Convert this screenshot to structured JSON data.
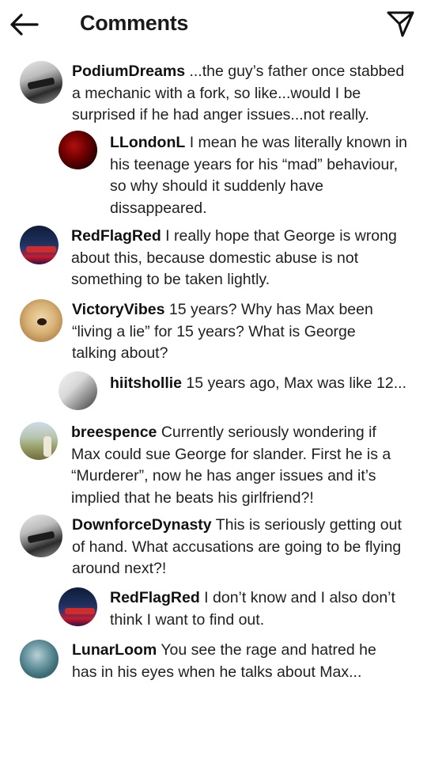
{
  "header": {
    "title": "Comments",
    "back_icon": "arrow-left-icon",
    "send_icon": "paper-plane-icon"
  },
  "comments": [
    {
      "username": "PodiumDreams",
      "text": " ...the guy’s father once stabbed a mechanic with a fork, so like...would I be surprised if he had anger issues...not really.",
      "avatar": "race-car-photo",
      "reply": false
    },
    {
      "username": "LLondonL",
      "text": " I mean he was literally known in his teenage years for his “mad” behaviour, so why should it suddenly have dissappeared.",
      "avatar": "red-roses-photo",
      "reply": true
    },
    {
      "username": "RedFlagRed",
      "text": " I really hope that George is wrong about this, because domestic abuse is not something to be taken lightly.",
      "avatar": "racing-team-photo",
      "reply": false
    },
    {
      "username": "VictoryVibes",
      "text": " 15 years? Why has Max been “living a lie” for 15 years? What is George talking about?",
      "avatar": "dog-photo",
      "reply": false
    },
    {
      "username": "hiitshollie",
      "text": " 15 years ago, Max was like 12...",
      "avatar": "couple-photo",
      "reply": true
    },
    {
      "username": "breespence",
      "text": " Currently seriously wondering if Max could sue George for slander. First he is a “Murderer”, now he has anger issues and it’s implied that he beats his girlfriend?!",
      "avatar": "field-horse-photo",
      "reply": false
    },
    {
      "username": "DownforceDynasty",
      "text": " This is seriously getting out of hand. What accusations are going to be flying around next?!",
      "avatar": "race-car-photo",
      "reply": false
    },
    {
      "username": "RedFlagRed",
      "text": " I don’t know and I also don’t think I want to find out.",
      "avatar": "racing-team-photo",
      "reply": true
    },
    {
      "username": "LunarLoom",
      "text": "  You see the rage and hatred he has in his eyes when he talks about Max...",
      "avatar": "sea-photo",
      "reply": false
    }
  ]
}
